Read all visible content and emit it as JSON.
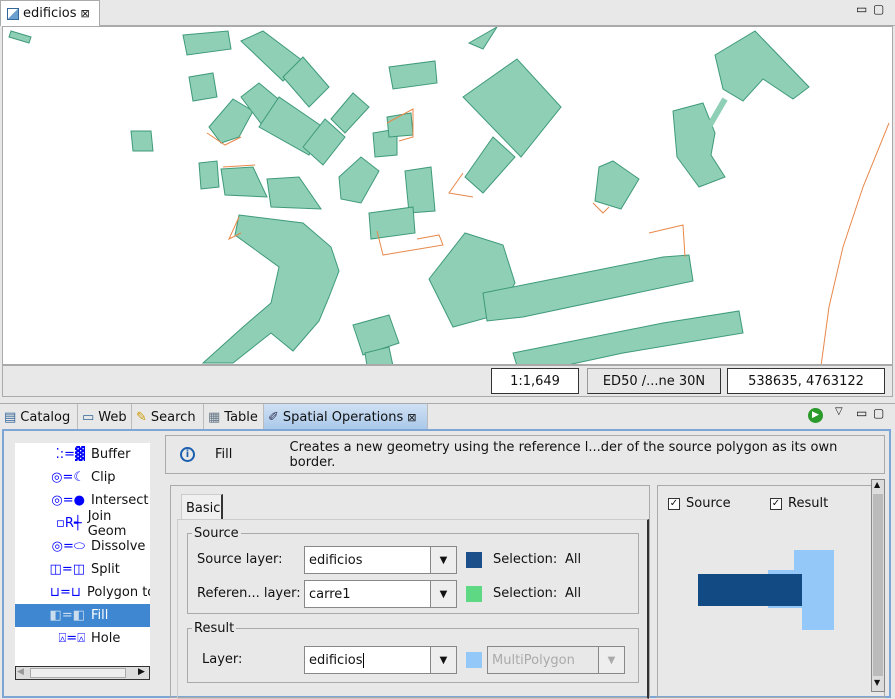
{
  "editor": {
    "tab_label": "edificios"
  },
  "status": {
    "scale": "1:1,649",
    "crs": "ED50 /...ne 30N",
    "coords": "538635, 4763122"
  },
  "views": {
    "tabs": [
      {
        "label": "Catalog",
        "icon": "catalog-icon"
      },
      {
        "label": "Web",
        "icon": "window-icon"
      },
      {
        "label": "Search",
        "icon": "search-icon"
      },
      {
        "label": "Table",
        "icon": "table-icon"
      },
      {
        "label": "Spatial Operations",
        "icon": "ruler-icon",
        "active": true
      }
    ]
  },
  "operations": [
    {
      "label": "Buffer"
    },
    {
      "label": "Clip"
    },
    {
      "label": "Intersect"
    },
    {
      "label": "Join Geom"
    },
    {
      "label": "Dissolve"
    },
    {
      "label": "Split"
    },
    {
      "label": "Polygon to"
    },
    {
      "label": "Fill",
      "selected": true
    },
    {
      "label": "Hole"
    }
  ],
  "info": {
    "name": "Fill",
    "description": "Creates a new geometry using the reference l...der of the source polygon as its own border."
  },
  "form": {
    "tab": "Basic",
    "source": {
      "legend": "Source",
      "source_label": "Source layer:",
      "source_value": "edificios",
      "source_color": "#1a4f8a",
      "source_sel_label": "Selection:",
      "source_sel_value": "All",
      "ref_label": "Referen... layer:",
      "ref_value": "carre1",
      "ref_color": "#5ed882",
      "ref_sel_label": "Selection:",
      "ref_sel_value": "All"
    },
    "result": {
      "legend": "Result",
      "layer_label": "Layer:",
      "layer_value": "edificios",
      "color": "#94c8f9",
      "geometry_type": "MultiPolygon"
    }
  },
  "preview": {
    "source_label": "Source",
    "source_checked": true,
    "result_label": "Result",
    "result_checked": true
  },
  "colors": {
    "building_fill": "#8ecfb6",
    "building_stroke": "#3f9a7a",
    "road": "#e8884a",
    "selection": "#3f87d0"
  }
}
